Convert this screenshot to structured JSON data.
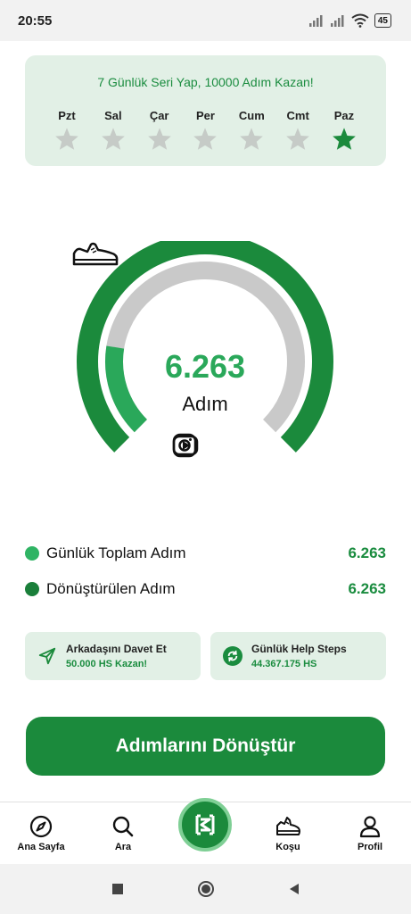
{
  "status_bar": {
    "time": "20:55",
    "battery": "45"
  },
  "streak": {
    "title": "7 Günlük Seri Yap, 10000 Adım Kazan!",
    "days": [
      {
        "label": "Pzt",
        "done": false
      },
      {
        "label": "Sal",
        "done": false
      },
      {
        "label": "Çar",
        "done": false
      },
      {
        "label": "Per",
        "done": false
      },
      {
        "label": "Cum",
        "done": false
      },
      {
        "label": "Cmt",
        "done": false
      },
      {
        "label": "Paz",
        "done": true
      }
    ]
  },
  "gauge": {
    "steps": "6.263",
    "unit": "Adım",
    "progress": 0.2,
    "icons": [
      "shoe-icon",
      "instagram-icon",
      "youtube-icon"
    ]
  },
  "stats": [
    {
      "label": "Günlük Toplam Adım",
      "value": "6.263",
      "color": "#2fb464"
    },
    {
      "label": "Dönüştürülen Adım",
      "value": "6.263",
      "color": "#1a7f3a"
    }
  ],
  "cards": {
    "invite": {
      "title": "Arkadaşını Davet Et",
      "sub": "50.000 HS Kazan!",
      "icon": "send-icon"
    },
    "help": {
      "title": "Günlük Help Steps",
      "sub": "44.367.175 HS",
      "icon": "refresh-icon"
    }
  },
  "convert_button": "Adımlarını Dönüştür",
  "nav": {
    "items": [
      {
        "label": "Ana Sayfa",
        "icon": "compass-icon"
      },
      {
        "label": "Ara",
        "icon": "search-icon"
      },
      {
        "label": "Koşu",
        "icon": "running-shoe-icon"
      },
      {
        "label": "Profil",
        "icon": "user-icon"
      }
    ],
    "center_icon": "hs-logo-icon"
  },
  "colors": {
    "accent": "#1b8a3c",
    "accent_light": "#2aa85a",
    "card_bg": "#e2f0e6",
    "gauge_track": "#c9c9c9"
  }
}
